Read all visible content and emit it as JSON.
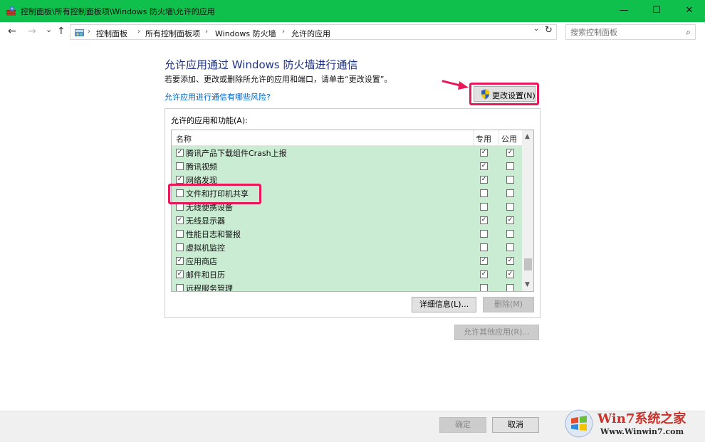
{
  "window": {
    "title": "控制面板\\所有控制面板项\\Windows 防火墙\\允许的应用",
    "minimize": "—",
    "maximize": "☐",
    "close": "✕"
  },
  "nav": {
    "back": "←",
    "forward": "→",
    "recent": "⌄",
    "up": "↑",
    "breadcrumbs": [
      "控制面板",
      "所有控制面板项",
      "Windows 防火墙",
      "允许的应用"
    ],
    "separator": "›",
    "dropdown": "⌄",
    "refresh": "↻",
    "search_placeholder": "搜索控制面板",
    "search_icon": "⌕"
  },
  "content": {
    "title": "允许应用通过 Windows 防火墙进行通信",
    "description": "若要添加、更改或删除所允许的应用和端口，请单击“更改设置”。",
    "risk_link": "允许应用进行通信有哪些风险?",
    "change_settings": "更改设置(N)",
    "group_label": "允许的应用和功能(A):",
    "columns": {
      "name": "名称",
      "private": "专用",
      "public": "公用"
    },
    "apps": [
      {
        "name": "腾讯产品下载组件Crash上报",
        "enabled": true,
        "private": true,
        "public": true
      },
      {
        "name": "腾讯视频",
        "enabled": false,
        "private": true,
        "public": false
      },
      {
        "name": "网络发现",
        "enabled": true,
        "private": true,
        "public": false
      },
      {
        "name": "文件和打印机共享",
        "enabled": false,
        "private": false,
        "public": false
      },
      {
        "name": "无线便携设备",
        "enabled": false,
        "private": false,
        "public": false
      },
      {
        "name": "无线显示器",
        "enabled": true,
        "private": true,
        "public": true
      },
      {
        "name": "性能日志和警报",
        "enabled": false,
        "private": false,
        "public": false
      },
      {
        "name": "虚拟机监控",
        "enabled": false,
        "private": false,
        "public": false
      },
      {
        "name": "应用商店",
        "enabled": true,
        "private": true,
        "public": true
      },
      {
        "name": "邮件和日历",
        "enabled": true,
        "private": true,
        "public": true
      },
      {
        "name": "远程服务管理",
        "enabled": false,
        "private": false,
        "public": false
      }
    ],
    "details_button": "详细信息(L)...",
    "remove_button": "删除(M)",
    "allow_other_button": "允许其他应用(R)..."
  },
  "footer": {
    "ok": "确定",
    "cancel": "取消"
  },
  "watermark": {
    "title": "Win7系统之家",
    "url": "Www.Winwin7.com"
  },
  "colors": {
    "titlebar": "#10c04c",
    "list_highlight": "#c9ecd2",
    "annotation": "#e8185a",
    "title_text": "#1e3287",
    "link": "#0066cc"
  }
}
